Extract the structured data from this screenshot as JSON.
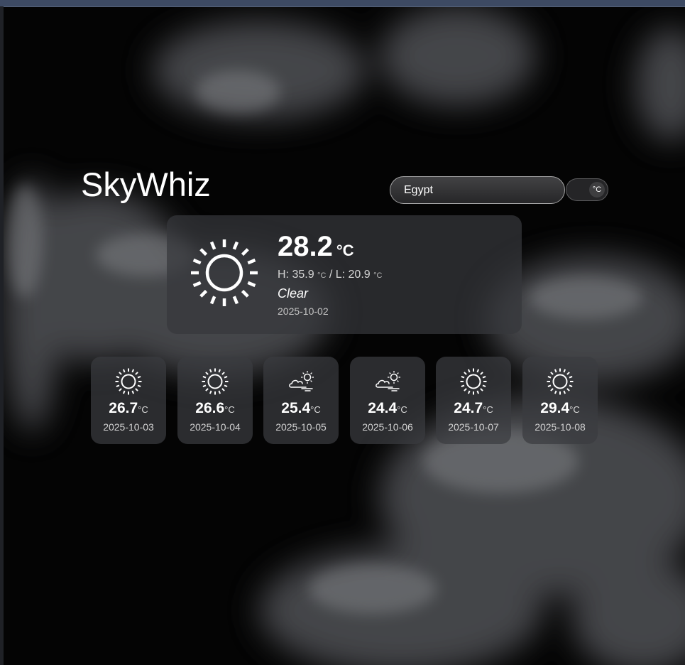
{
  "app": {
    "title": "SkyWhiz"
  },
  "search": {
    "value": "Egypt"
  },
  "unit_toggle": {
    "label": "°C"
  },
  "current": {
    "temp": "28.2",
    "unit": "°C",
    "high_label": "H: ",
    "high": "35.9",
    "separator": " / ",
    "low_label": "L: ",
    "low": "20.9",
    "unit_small": "°C",
    "condition": "Clear",
    "date": "2025-10-02",
    "icon": "sun-icon"
  },
  "forecast": [
    {
      "temp": "26.7",
      "unit": "°C",
      "date": "2025-10-03",
      "icon": "sun-icon"
    },
    {
      "temp": "26.6",
      "unit": "°C",
      "date": "2025-10-04",
      "icon": "sun-icon"
    },
    {
      "temp": "25.4",
      "unit": "°C",
      "date": "2025-10-05",
      "icon": "partly-cloudy-icon"
    },
    {
      "temp": "24.4",
      "unit": "°C",
      "date": "2025-10-06",
      "icon": "partly-cloudy-icon"
    },
    {
      "temp": "24.7",
      "unit": "°C",
      "date": "2025-10-07",
      "icon": "sun-icon"
    },
    {
      "temp": "29.4",
      "unit": "°C",
      "date": "2025-10-08",
      "icon": "sun-icon"
    }
  ]
}
